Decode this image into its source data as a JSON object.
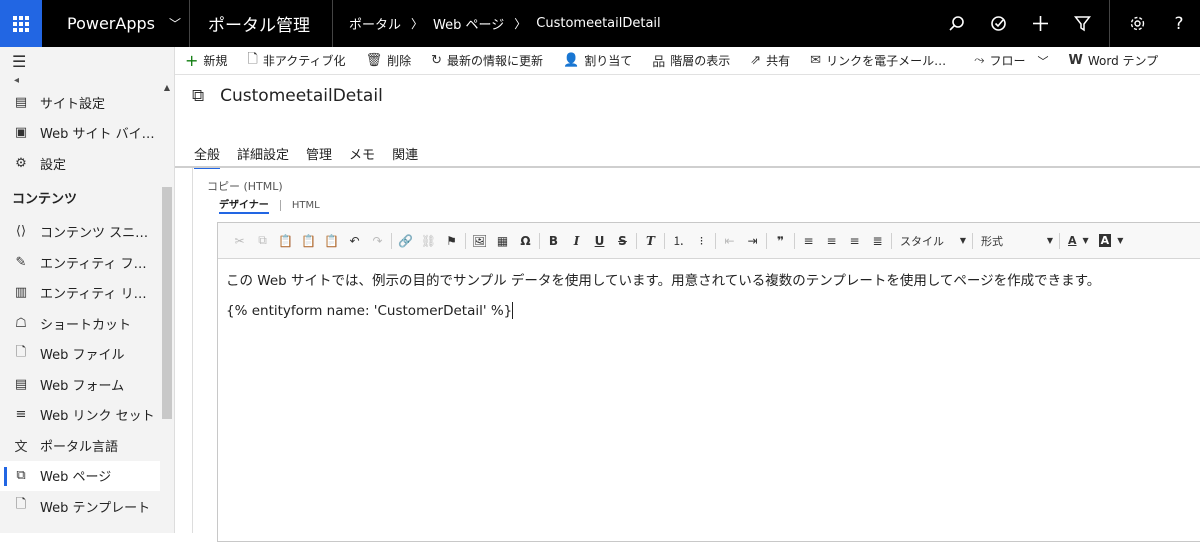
{
  "topbar": {
    "app_name": "PowerApps",
    "portal_title": "ポータル管理",
    "breadcrumbs": [
      "ポータル",
      "Web ページ",
      "CustomeetailDetail"
    ],
    "icons": [
      "search-icon",
      "target-icon",
      "plus-icon",
      "filter-icon",
      "gear-icon",
      "help-icon"
    ],
    "help_glyph": "?",
    "brand_color": "#2266e3"
  },
  "sidebar": {
    "top_items": [
      {
        "label": "サイト設定",
        "icon": "site-settings-icon"
      },
      {
        "label": "Web サイト バイ…",
        "icon": "website-binding-icon"
      },
      {
        "label": "設定",
        "icon": "gear-icon"
      }
    ],
    "section_title": "コンテンツ",
    "content_items": [
      {
        "label": "コンテンツ スニ…",
        "icon": "content-snippet-icon"
      },
      {
        "label": "エンティティ フ…",
        "icon": "entity-form-icon"
      },
      {
        "label": "エンティティ リ…",
        "icon": "entity-list-icon"
      },
      {
        "label": "ショートカット",
        "icon": "shortcut-icon"
      },
      {
        "label": "Web ファイル",
        "icon": "web-file-icon"
      },
      {
        "label": "Web フォーム",
        "icon": "web-form-icon"
      },
      {
        "label": "Web リンク セット",
        "icon": "web-link-set-icon"
      },
      {
        "label": "ポータル言語",
        "icon": "portal-language-icon"
      },
      {
        "label": "Web ページ",
        "icon": "web-page-icon",
        "active": true
      },
      {
        "label": "Web テンプレート",
        "icon": "web-template-icon"
      }
    ]
  },
  "commands": [
    {
      "label": "新規",
      "icon": "plus-icon"
    },
    {
      "label": "非アクティブ化",
      "icon": "deactivate-icon"
    },
    {
      "label": "削除",
      "icon": "delete-icon"
    },
    {
      "label": "最新の情報に更新",
      "icon": "refresh-icon"
    },
    {
      "label": "割り当て",
      "icon": "assign-icon"
    },
    {
      "label": "階層の表示",
      "icon": "hierarchy-icon"
    },
    {
      "label": "共有",
      "icon": "share-icon"
    },
    {
      "label": "リンクを電子メール…",
      "icon": "email-link-icon"
    },
    {
      "label": "フロー",
      "icon": "flow-icon"
    },
    {
      "label": "Word テンプ",
      "icon": "word-icon"
    }
  ],
  "record": {
    "title": "CustomeetailDetail",
    "icon": "web-page-icon"
  },
  "tabs": [
    "全般",
    "詳細設定",
    "管理",
    "メモ",
    "関連"
  ],
  "field": {
    "label": "コピー (HTML)",
    "mode_tabs": [
      "デザイナー",
      "HTML"
    ]
  },
  "editor": {
    "style_dropdown": "スタイル",
    "format_dropdown": "形式",
    "font_color_glyph": "A",
    "bg_color_glyph": "A",
    "paragraphs": [
      "この Web サイトでは、例示の目的でサンプル データを使用しています。用意されている複数のテンプレートを使用してページを作成できます。",
      "{% entityform name: 'CustomerDetail' %}"
    ]
  }
}
